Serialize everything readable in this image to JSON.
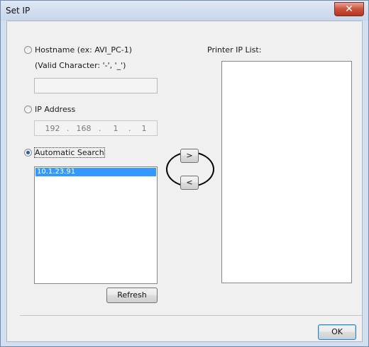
{
  "window": {
    "title": "Set IP",
    "close_glyph": "✕"
  },
  "hostname": {
    "radio_label": "Hostname (ex: AVI_PC-1)",
    "valid_chars": "(Valid Character: '-', '_')",
    "value": "",
    "selected": false
  },
  "ip_address": {
    "radio_label": "IP Address",
    "octets": [
      "192",
      "168",
      "1",
      "1"
    ],
    "separator": ".",
    "selected": false
  },
  "automatic_search": {
    "radio_label": "Automatic Search",
    "selected": true,
    "results": [
      "10.1.23.91"
    ],
    "selected_index": 0,
    "refresh_label": "Refresh"
  },
  "transfer": {
    "add_label": ">",
    "remove_label": "<"
  },
  "printer_ip_list": {
    "label": "Printer IP List:",
    "items": []
  },
  "footer": {
    "ok_label": "OK"
  }
}
